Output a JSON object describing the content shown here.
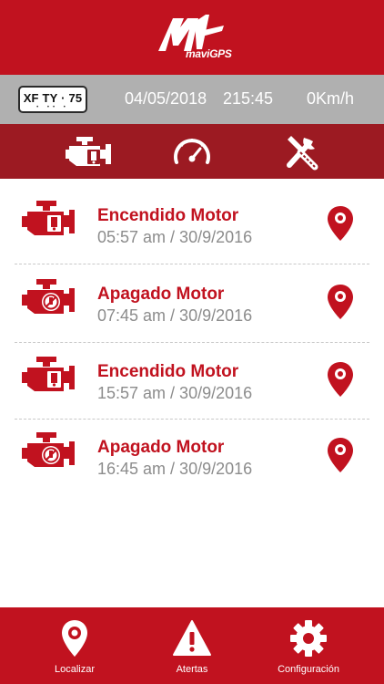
{
  "brand": {
    "logo_text": "maviGPS"
  },
  "status": {
    "plate": "XF TY · 75",
    "plate_dots": "• •• •",
    "date": "04/05/2018",
    "time": "215:45",
    "speed": "0Km/h"
  },
  "tabs": [
    {
      "icon": "engine-icon",
      "active": true
    },
    {
      "icon": "speedometer-icon",
      "active": false
    },
    {
      "icon": "tools-icon",
      "active": false
    }
  ],
  "events": [
    {
      "title": "Encendido Motor",
      "subtitle": "05:57 am / 30/9/2016",
      "icon": "engine-on-icon"
    },
    {
      "title": "Apagado Motor",
      "subtitle": "07:45 am / 30/9/2016",
      "icon": "engine-off-icon"
    },
    {
      "title": "Encendido Motor",
      "subtitle": "15:57 am / 30/9/2016",
      "icon": "engine-on-icon"
    },
    {
      "title": "Apagado Motor",
      "subtitle": "16:45 am / 30/9/2016",
      "icon": "engine-off-icon"
    }
  ],
  "footer": {
    "localizar": "Localizar",
    "alertas": "Atertas",
    "configuracion": "Configuración"
  },
  "colors": {
    "primary": "#c1121f",
    "tabbar": "#9c1a22",
    "statusbar": "#b0b0b0"
  }
}
